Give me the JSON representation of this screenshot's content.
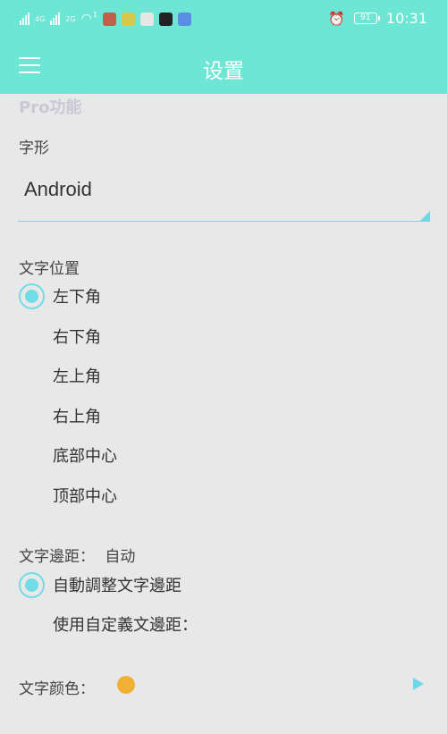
{
  "status_bar": {
    "network_1": "4G",
    "network_2": "2G",
    "wifi_badge": "1",
    "battery_level": "91",
    "time": "10:31",
    "app_icons": [
      "news-app-icon",
      "pinduoduo-app-icon",
      "mascot-app-icon",
      "tiktok-app-icon",
      "baidu-app-icon"
    ]
  },
  "header": {
    "title": "设置",
    "menu_icon": "hamburger-menu-icon"
  },
  "settings": {
    "pro_label": "Pro功能",
    "font_label": "字形",
    "font_value": "Android",
    "text_position_label": "文字位置",
    "text_positions": [
      "左下角",
      "右下角",
      "左上角",
      "右上角",
      "底部中心",
      "顶部中心"
    ],
    "text_position_selected": 0,
    "margin_label": "文字邊距：",
    "margin_value": "自动",
    "margin_options": [
      "自動調整文字邊距",
      "使用自定義文邊距："
    ],
    "margin_selected": 0,
    "text_color_label": "文字颜色：",
    "text_color": "#f0b036",
    "accent_color": "#6ee6d6"
  }
}
